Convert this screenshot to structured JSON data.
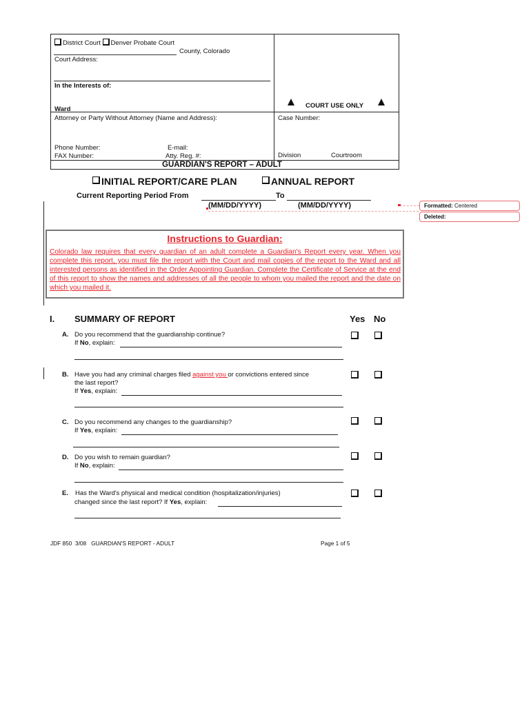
{
  "caption_box": {
    "court_options": [
      "District Court",
      "Denver Probate Court"
    ],
    "county_suffix": "County, Colorado",
    "court_address_label": "Court Address:",
    "interests_label": "In the Interests of:",
    "ward_label": "Ward",
    "attorney_label": "Attorney or Party Without Attorney (Name and Address):",
    "phone_label": "Phone Number:",
    "fax_label": "FAX Number:",
    "email_label": "E-mail:",
    "atty_reg_label": "Atty. Reg. #:",
    "court_use_only": "COURT USE ONLY",
    "case_number_label": "Case Number:",
    "division_label": "Division",
    "courtroom_label": "Courtroom",
    "form_title": "GUARDIAN'S REPORT – ADULT"
  },
  "report_type": {
    "options": [
      "INITIAL REPORT/CARE PLAN",
      "ANNUAL REPORT"
    ],
    "period_label": "Current Reporting Period From",
    "to_label": "To",
    "date_format_from": "(MM/DD/YYYY)",
    "date_format_to": "(MM/DD/YYYY)"
  },
  "comments": [
    {
      "label": "Formatted:",
      "value": "Centered"
    },
    {
      "label": "Deleted:",
      "value": ""
    }
  ],
  "instructions": {
    "title": "Instructions to Guardian:",
    "body": "Colorado law requires that every guardian of an adult complete a Guardian's Report every year.  When you complete this report, you must file the report with the Court and mail copies of the report to the Ward and all interested persons as identified in the Order Appointing Guardian.  Complete the Certificate of Service at the end of this report to show the names and addresses of all the people to whom you mailed the report and the date on which you mailed it."
  },
  "summary": {
    "section_number": "I.",
    "section_title": "SUMMARY OF REPORT",
    "yes_label": "Yes",
    "no_label": "No",
    "questions": [
      {
        "letter": "A.",
        "line1": "Do you recommend that the guardianship continue?",
        "explain_prefix": "If ",
        "explain_bold": "No",
        "explain_suffix": ", explain:"
      },
      {
        "letter": "B.",
        "line1_pre": "Have you had any criminal charges filed ",
        "line1_inserted": "against you ",
        "line1_post": "or convictions entered since",
        "line2": "the last report?",
        "explain_prefix": "If ",
        "explain_bold": "Yes",
        "explain_suffix": ", explain:"
      },
      {
        "letter": "C.",
        "line1": "Do you recommend any changes to the guardianship?",
        "explain_prefix": "If ",
        "explain_bold": "Yes",
        "explain_suffix": ", explain:"
      },
      {
        "letter": "D.",
        "line1": "Do you wish to remain guardian?",
        "explain_prefix": "If ",
        "explain_bold": "No",
        "explain_suffix": ", explain:"
      },
      {
        "letter": "E.",
        "line1": "Has the Ward's physical and medical condition (hospitalization/injuries)",
        "line2_pre": "changed since the last report?  If ",
        "explain_bold": "Yes",
        "explain_suffix": ", explain:"
      }
    ]
  },
  "footer": {
    "form_id": "JDF 850",
    "revision": "3/08",
    "form_name": "GUARDIAN'S REPORT - ADULT",
    "page": "Page 1 of 5"
  }
}
